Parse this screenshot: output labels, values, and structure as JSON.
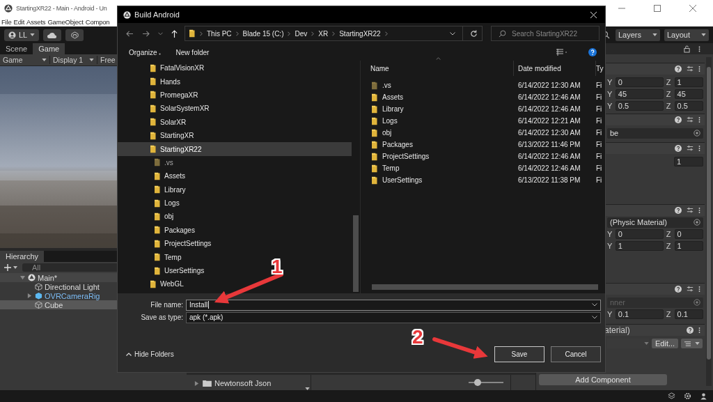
{
  "unity": {
    "title": "StartingXR22 - Main - Android - Un",
    "menu": [
      "File",
      "Edit",
      "Assets",
      "GameObject",
      "Compon"
    ],
    "account": "LL",
    "layers": "Layers",
    "layout": "Layout",
    "view_tabs": [
      {
        "label": "Scene",
        "selected": false
      },
      {
        "label": "Game",
        "selected": true
      }
    ],
    "game_toolbar": [
      "Game",
      "Display 1",
      "Free"
    ],
    "hierarchy": {
      "title": "Hierarchy",
      "search_placeholder": "All",
      "items": [
        {
          "label": "Main*",
          "kind": "scene",
          "expanded": true,
          "selected": false,
          "children": [
            {
              "label": "Directional Light",
              "kind": "object",
              "selected": false
            },
            {
              "label": "OVRCameraRig",
              "kind": "prefab",
              "expanded": false,
              "selected": false
            },
            {
              "label": "Cube",
              "kind": "object",
              "selected": true
            }
          ]
        }
      ]
    },
    "project": {
      "items": [
        {
          "label": "Newtonsoft Json"
        }
      ],
      "thumbnail_slider": {
        "level": 0.25
      }
    },
    "inspector": {
      "components": [
        {
          "rows": [
            {
              "kind": "vector",
              "fields": [
                {
                  "axis": "Y",
                  "value": "0"
                },
                {
                  "axis": "Z",
                  "value": "1"
                }
              ]
            },
            {
              "kind": "vector",
              "fields": [
                {
                  "axis": "Y",
                  "value": "45"
                },
                {
                  "axis": "Z",
                  "value": "45"
                }
              ]
            },
            {
              "kind": "vector",
              "fields": [
                {
                  "axis": "Y",
                  "value": "0.5"
                },
                {
                  "axis": "Z",
                  "value": "0.5"
                }
              ]
            }
          ]
        },
        {
          "rows": [
            {
              "kind": "object",
              "value": "be",
              "disabled": false
            }
          ]
        },
        {
          "rows": [
            {
              "kind": "number",
              "value": "1"
            }
          ]
        },
        {
          "rows": [
            {
              "kind": "object",
              "value": "(Physic Material)",
              "disabled": false
            },
            {
              "kind": "vector",
              "fields": [
                {
                  "axis": "Y",
                  "value": "0"
                },
                {
                  "axis": "Z",
                  "value": "0"
                }
              ]
            },
            {
              "kind": "vector",
              "fields": [
                {
                  "axis": "Y",
                  "value": "1"
                },
                {
                  "axis": "Z",
                  "value": "1"
                }
              ]
            }
          ]
        },
        {
          "rows": [
            {
              "kind": "object",
              "value": "nner",
              "disabled": true
            },
            {
              "kind": "vector",
              "fields": [
                {
                  "axis": "Y",
                  "value": "0.1"
                },
                {
                  "axis": "Z",
                  "value": "0.1"
                }
              ]
            }
          ]
        },
        {
          "title": "aterial)",
          "rows": [
            {
              "kind": "material",
              "button": "Edit..."
            }
          ]
        }
      ],
      "add_component": "Add Component"
    }
  },
  "dialog": {
    "title": "Build Android",
    "breadcrumb": [
      "This PC",
      "Blade 15 (C:)",
      "Dev",
      "XR",
      "StartingXR22"
    ],
    "search_placeholder": "Search StartingXR22",
    "commands": [
      "Organize",
      "New folder"
    ],
    "tree": [
      {
        "label": "FatalVisionXR",
        "selected": false
      },
      {
        "label": "Hands",
        "selected": false
      },
      {
        "label": "PromegaXR",
        "selected": false
      },
      {
        "label": "SolarSystemXR",
        "selected": false
      },
      {
        "label": "SolarXR",
        "selected": false
      },
      {
        "label": "StartingXR",
        "selected": false
      },
      {
        "label": "StartingXR22",
        "selected": true,
        "children": [
          {
            "label": ".vs",
            "selected": false,
            "hidden": true
          },
          {
            "label": "Assets",
            "selected": false,
            "hidden": false
          },
          {
            "label": "Library",
            "selected": false,
            "hidden": false
          },
          {
            "label": "Logs",
            "selected": false,
            "hidden": false
          },
          {
            "label": "obj",
            "selected": false,
            "hidden": false
          },
          {
            "label": "Packages",
            "selected": false,
            "hidden": false
          },
          {
            "label": "ProjectSettings",
            "selected": false,
            "hidden": false
          },
          {
            "label": "Temp",
            "selected": false,
            "hidden": false
          },
          {
            "label": "UserSettings",
            "selected": false,
            "hidden": false
          }
        ]
      },
      {
        "label": "WebGL",
        "selected": false
      }
    ],
    "columns": [
      "Name",
      "Date modified",
      "Ty"
    ],
    "files": [
      {
        "name": ".vs",
        "date": "6/14/2022 12:30 AM",
        "type": "Fi",
        "hidden": true
      },
      {
        "name": "Assets",
        "date": "6/14/2022 12:46 AM",
        "type": "Fi",
        "hidden": false
      },
      {
        "name": "Library",
        "date": "6/14/2022 12:46 AM",
        "type": "Fi",
        "hidden": false
      },
      {
        "name": "Logs",
        "date": "6/14/2022 12:21 AM",
        "type": "Fi",
        "hidden": false
      },
      {
        "name": "obj",
        "date": "6/14/2022 12:30 AM",
        "type": "Fi",
        "hidden": false
      },
      {
        "name": "Packages",
        "date": "6/13/2022 11:46 PM",
        "type": "Fi",
        "hidden": false
      },
      {
        "name": "ProjectSettings",
        "date": "6/14/2022 12:46 AM",
        "type": "Fi",
        "hidden": false
      },
      {
        "name": "Temp",
        "date": "6/14/2022 12:46 AM",
        "type": "Fi",
        "hidden": false
      },
      {
        "name": "UserSettings",
        "date": "6/13/2022 11:38 PM",
        "type": "Fi",
        "hidden": false
      }
    ],
    "file_name": {
      "label": "File name:",
      "value": "Install"
    },
    "save_as_type": {
      "label": "Save as type:",
      "value": "apk (*.apk)"
    },
    "hide_folders": "Hide Folders",
    "buttons": [
      {
        "label": "Save",
        "kind": "primary"
      },
      {
        "label": "Cancel",
        "kind": "secondary"
      }
    ]
  },
  "annotations": [
    {
      "label": "1"
    },
    {
      "label": "2"
    }
  ]
}
